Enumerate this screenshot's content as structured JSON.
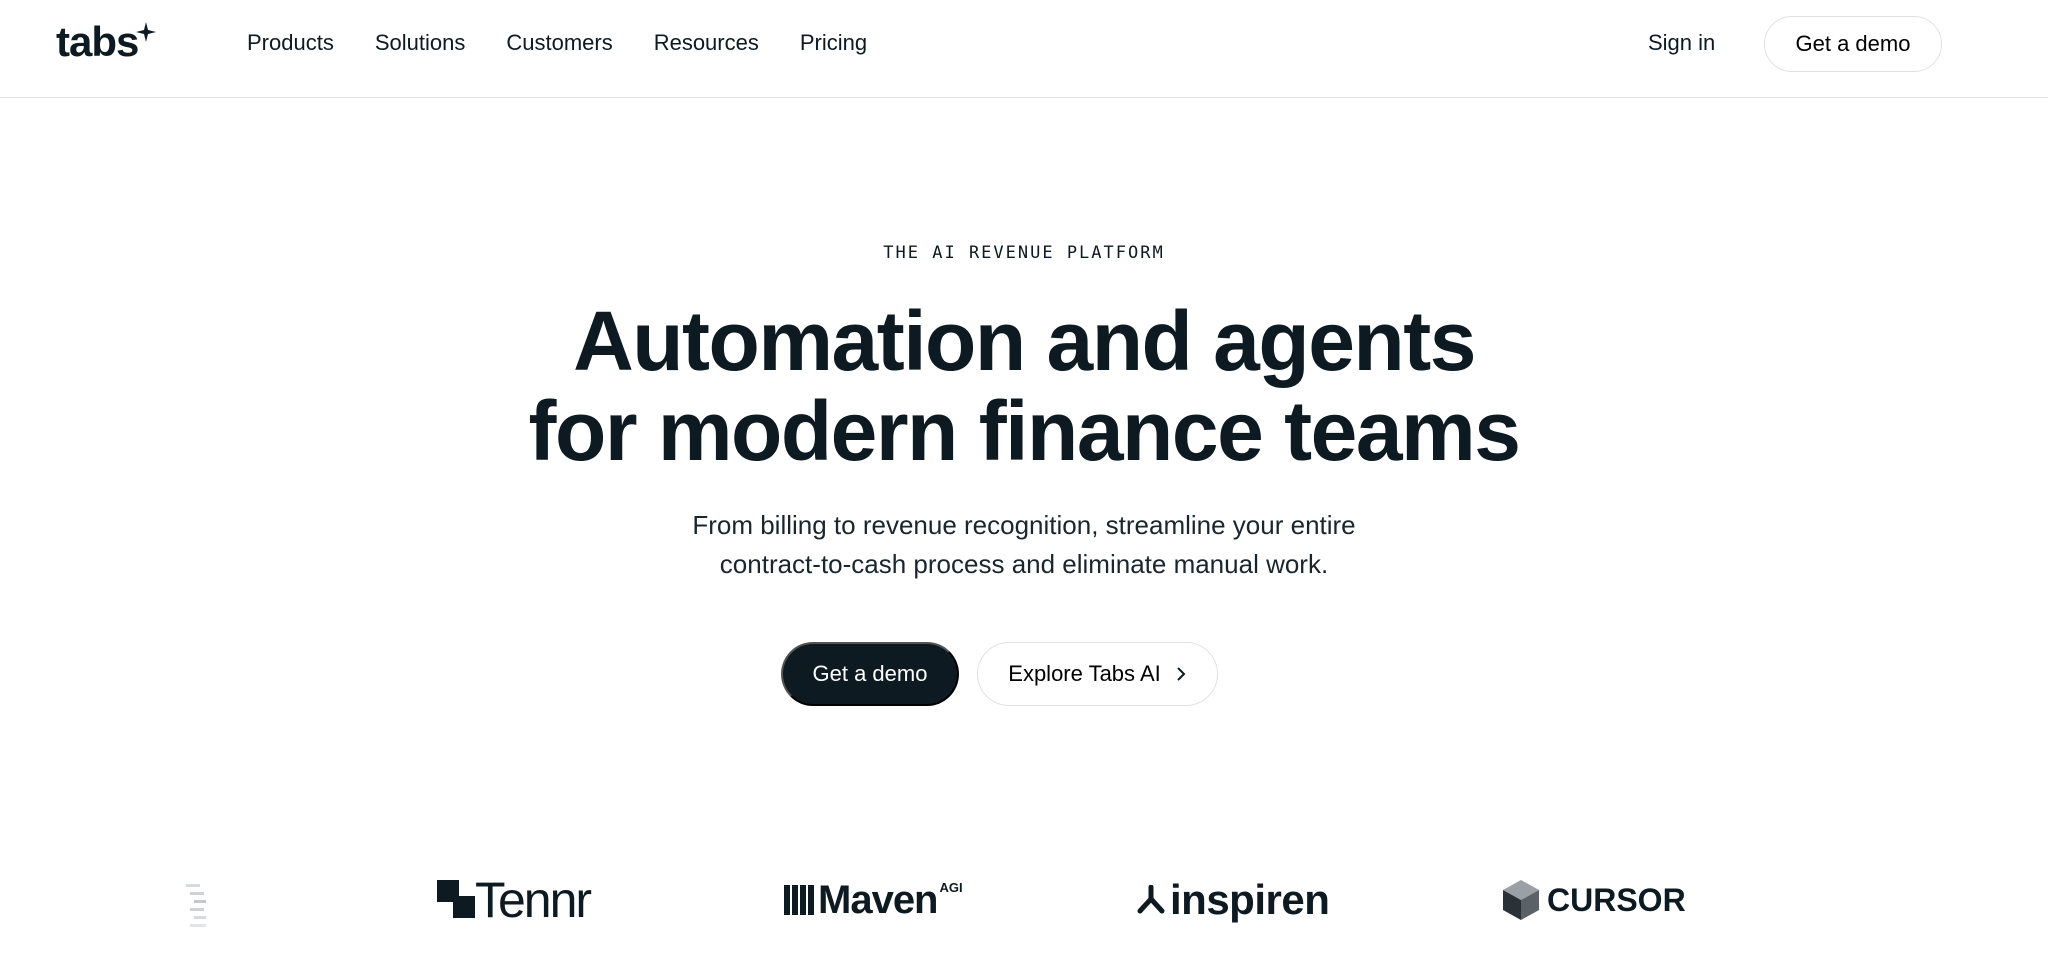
{
  "header": {
    "brand": "tabs",
    "nav": [
      "Products",
      "Solutions",
      "Customers",
      "Resources",
      "Pricing"
    ],
    "sign_in": "Sign in",
    "cta": "Get a demo"
  },
  "hero": {
    "eyebrow": "THE AI REVENUE PLATFORM",
    "headline_line1": "Automation and agents",
    "headline_line2": "for modern finance teams",
    "subtitle_line1": "From billing to revenue recognition, streamline your entire",
    "subtitle_line2": "contract-to-cash process and eliminate manual work.",
    "primary_cta": "Get a demo",
    "secondary_cta": "Explore Tabs AI"
  },
  "customer_logos": {
    "tennr": "Tennr",
    "maven": "Maven",
    "maven_sup": "AGI",
    "inspiren": "inspiren",
    "cursor": "CURSOR"
  },
  "icons": {
    "logo_star": "sparkle-icon",
    "secondary_cta": "chevron-right-icon"
  },
  "colors": {
    "ink": "#0d1a22",
    "border": "#dfe2e5",
    "background": "#ffffff"
  }
}
